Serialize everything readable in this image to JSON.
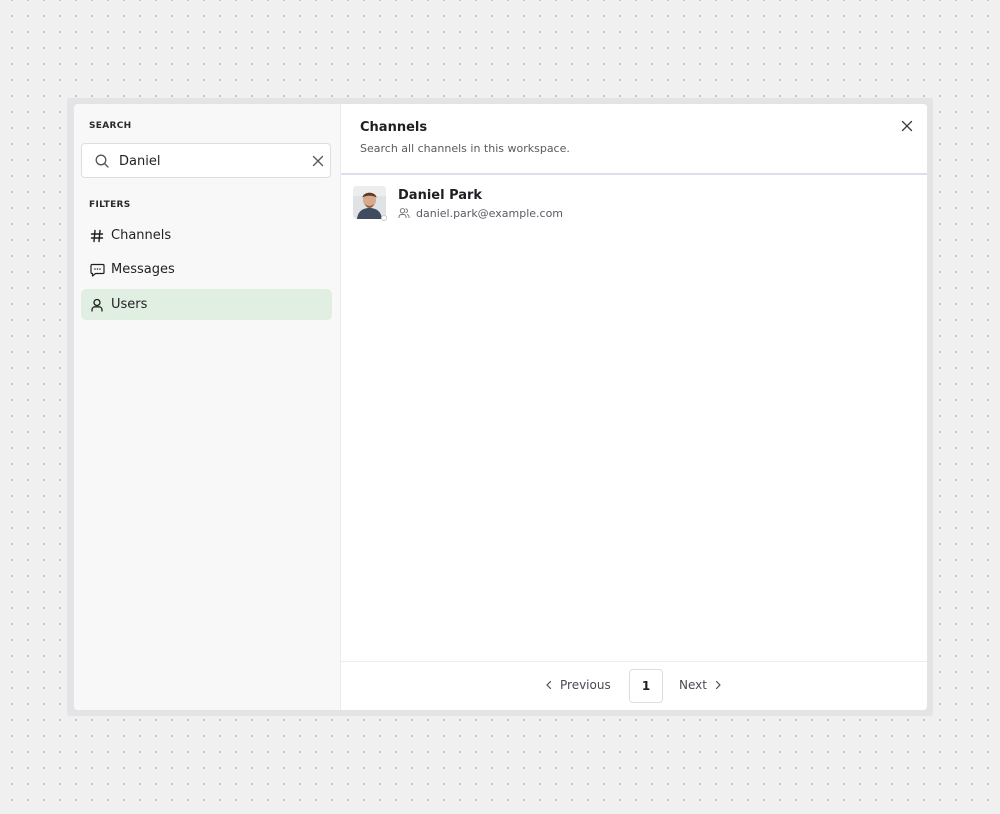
{
  "sidebar": {
    "search_label": "SEARCH",
    "search": {
      "value": "Daniel",
      "placeholder": ""
    },
    "filters_label": "FILTERS",
    "filters": [
      {
        "label": "Channels",
        "icon": "hash-icon",
        "active": false
      },
      {
        "label": "Messages",
        "icon": "message-icon",
        "active": false
      },
      {
        "label": "Users",
        "icon": "user-icon",
        "active": true
      }
    ]
  },
  "main": {
    "title": "Channels",
    "subtitle": "Search all channels in this workspace.",
    "results": [
      {
        "name": "Daniel Park",
        "email": "daniel.park@example.com",
        "icon": "users-icon"
      }
    ],
    "pagination": {
      "previous_label": "Previous",
      "current_page": "1",
      "next_label": "Next"
    }
  },
  "colors": {
    "active_filter_bg": "#e1efe2",
    "header_divider": "#e0dcf0",
    "page_bg": "#f0f0f0"
  }
}
